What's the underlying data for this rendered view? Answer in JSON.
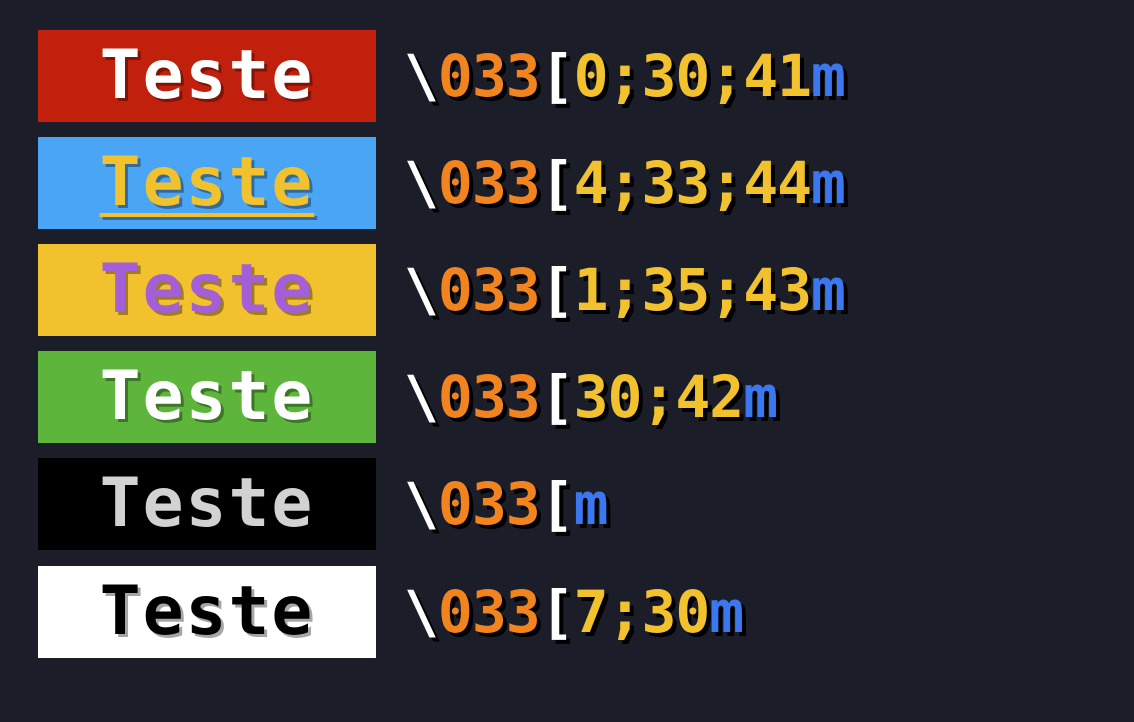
{
  "rows": [
    {
      "label": "Teste",
      "bg": "#c0200c",
      "fg": "#ffffff",
      "underline": false,
      "code": {
        "escape": "\\",
        "num": "033",
        "bracket": "[",
        "params": "0;30;41",
        "term": "m"
      }
    },
    {
      "label": "Teste",
      "bg": "#4aa6f5",
      "fg": "#f2c12e",
      "underline": true,
      "code": {
        "escape": "\\",
        "num": "033",
        "bracket": "[",
        "params": "4;33;44",
        "term": "m"
      }
    },
    {
      "label": "Teste",
      "bg": "#f2c12e",
      "fg": "#a35ed8",
      "underline": false,
      "code": {
        "escape": "\\",
        "num": "033",
        "bracket": "[",
        "params": "1;35;43",
        "term": "m"
      }
    },
    {
      "label": "Teste",
      "bg": "#5db53b",
      "fg": "#ffffff",
      "underline": false,
      "code": {
        "escape": "\\",
        "num": "033",
        "bracket": "[",
        "params": "30;42",
        "term": "m"
      }
    },
    {
      "label": "Teste",
      "bg": "#000000",
      "fg": "#d2d2d2",
      "underline": false,
      "code": {
        "escape": "\\",
        "num": "033",
        "bracket": "[",
        "params": "",
        "term": "m"
      }
    },
    {
      "label": "Teste",
      "bg": "#ffffff",
      "fg": "#000000",
      "underline": false,
      "code": {
        "escape": "\\",
        "num": "033",
        "bracket": "[",
        "params": "7;30",
        "term": "m"
      }
    }
  ]
}
